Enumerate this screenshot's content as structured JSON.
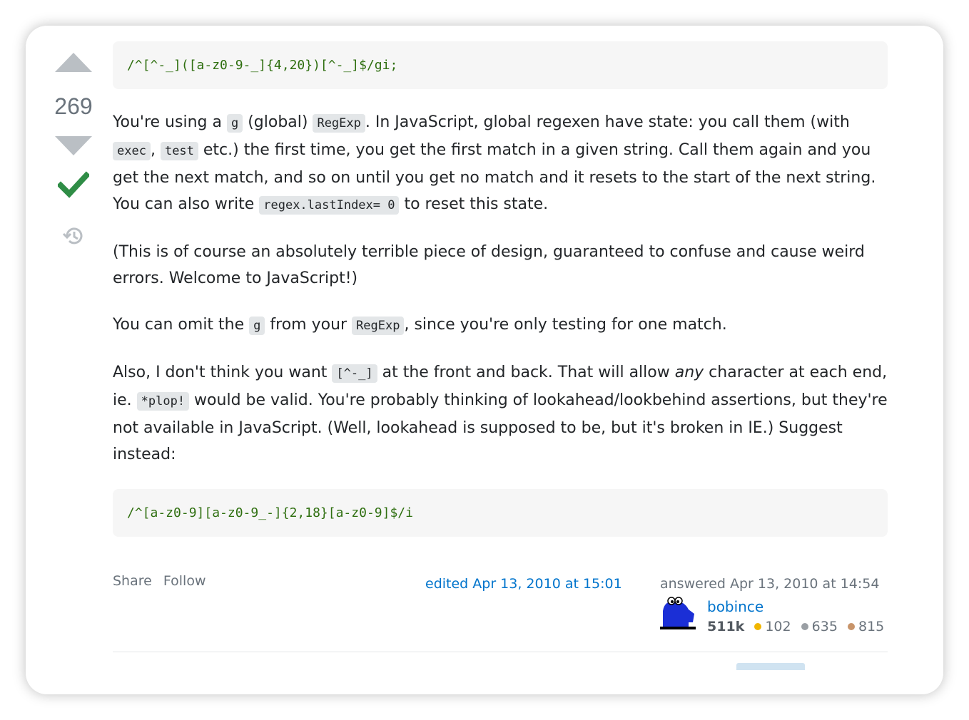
{
  "votes": {
    "count": "269"
  },
  "post": {
    "code1": "/^[^-_]([a-z0-9-_]{4,20})[^-_]$/gi;",
    "p1": {
      "t1": "You're using a ",
      "c1": "g",
      "t2": " (global) ",
      "c2": "RegExp",
      "t3": ". In JavaScript, global regexen have state: you call them (with ",
      "c3": "exec",
      "t4": ", ",
      "c4": "test",
      "t5": " etc.) the first time, you get the first match in a given string. Call them again and you get the next match, and so on until you get no match and it resets to the start of the next string. You can also write ",
      "c5": "regex.lastIndex= 0",
      "t6": " to reset this state."
    },
    "p2": "(This is of course an absolutely terrible piece of design, guaranteed to confuse and cause weird errors. Welcome to JavaScript!)",
    "p3": {
      "t1": "You can omit the ",
      "c1": "g",
      "t2": " from your ",
      "c2": "RegExp",
      "t3": ", since you're only testing for one match."
    },
    "p4": {
      "t1": "Also, I don't think you want ",
      "c1": "[^-_]",
      "t2": " at the front and back. That will allow ",
      "em": "any",
      "t3": " character at each end, ie. ",
      "c2": "*plop!",
      "t4": " would be valid. You're probably thinking of lookahead/lookbehind assertions, but they're not available in JavaScript. (Well, lookahead is supposed to be, but it's broken in IE.) Suggest instead:"
    },
    "code2": "/^[a-z0-9][a-z0-9_-]{2,18}[a-z0-9]$/i"
  },
  "footer": {
    "share": "Share",
    "follow": "Follow",
    "edited": "edited Apr 13, 2010 at 15:01",
    "answered": "answered Apr 13, 2010 at 14:54",
    "user": {
      "name": "bobince",
      "reputation": "511k",
      "gold": "102",
      "silver": "635",
      "bronze": "815"
    }
  },
  "colors": {
    "gold": "#f1b600",
    "silver": "#9a9fa4",
    "bronze": "#c8946a",
    "accepted": "#2f8d46",
    "link": "#0074cc"
  },
  "icons": [
    "upvote-icon",
    "downvote-icon",
    "accepted-check-icon",
    "history-icon",
    "avatar-monster-icon"
  ]
}
